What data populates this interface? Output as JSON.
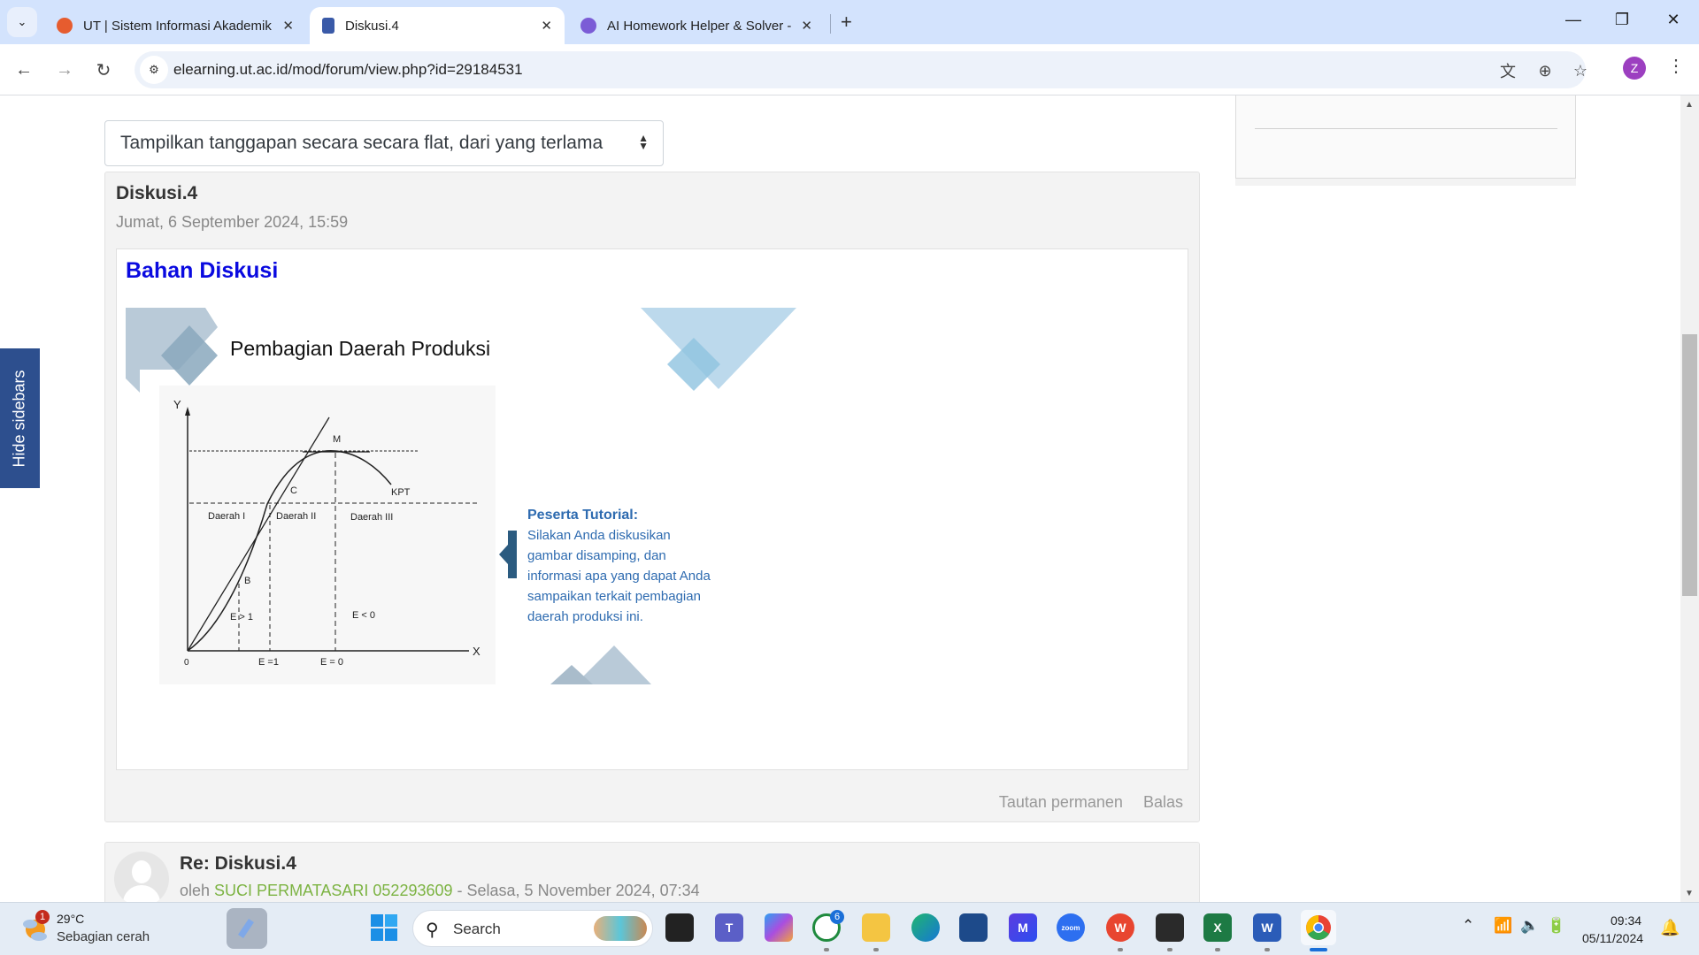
{
  "browser": {
    "tabs": [
      {
        "title": "UT | Sistem Informasi Akademik",
        "active": false,
        "favicon_color": "#e65c2f"
      },
      {
        "title": "Diskusi.4",
        "active": true,
        "favicon_color": "#3a5aa8"
      },
      {
        "title": "AI Homework Helper & Solver -",
        "active": false,
        "favicon_color": "#7b5cd6"
      }
    ],
    "close_glyph": "✕",
    "new_tab_glyph": "+",
    "url": "elearning.ut.ac.id/mod/forum/view.php?id=29184531",
    "profile_initial": "Z",
    "window_controls": {
      "minimize": "—",
      "restore": "❐",
      "close": "✕"
    },
    "nav": {
      "back": "←",
      "forward": "→",
      "reload": "↻"
    }
  },
  "page": {
    "hide_sidebars_label": "Hide sidebars",
    "sort_select": {
      "value": "Tampilkan tanggapan secara secara flat, dari yang terlama"
    },
    "discussion": {
      "title": "Diskusi.4",
      "date": "Jumat, 6 September 2024, 15:59",
      "content_heading": "Bahan Diskusi",
      "slide": {
        "title": "Pembagian Daerah Produksi",
        "graph_labels": {
          "y_axis": "Y",
          "x_axis": "X",
          "origin": "0",
          "point_m": "M",
          "point_c": "C",
          "point_b": "B",
          "curve": "KPT",
          "region_1": "Daerah I",
          "region_2": "Daerah II",
          "region_3": "Daerah III",
          "e_gt_1": "E > 1",
          "e_lt_0": "E < 0",
          "e_eq_1": "E =1",
          "e_eq_0": "E = 0"
        },
        "prompt_heading": "Peserta Tutorial:",
        "prompt_lines": [
          "Silakan Anda diskusikan",
          "gambar disamping, dan",
          "informasi apa yang dapat Anda",
          "sampaikan terkait pembagian",
          "daerah produksi ini."
        ]
      },
      "actions": {
        "permalink": "Tautan permanen",
        "reply": "Balas"
      }
    },
    "reply": {
      "title": "Re: Diskusi.4",
      "by_prefix": "oleh",
      "author": "SUCI PERMATASARI 052293609",
      "separator": " - ",
      "date": "Selasa, 5 November 2024, 07:34"
    }
  },
  "taskbar": {
    "weather": {
      "temp": "29°C",
      "desc": "Sebagian cerah",
      "badge": "1"
    },
    "search_label": "Search",
    "whatsapp_badge": "6",
    "apps": [
      "widgets",
      "start",
      "search",
      "task-view",
      "teams",
      "copilot",
      "whatsapp",
      "file-explorer",
      "edge",
      "store",
      "app-m",
      "zoom",
      "wps-office",
      "sticky-notes",
      "excel",
      "word",
      "chrome"
    ],
    "clock": {
      "time": "09:34",
      "date": "05/11/2024"
    }
  },
  "colors": {
    "accent_blue": "#0a0ae0",
    "sidebar_toggle": "#2d4f8e",
    "author_green": "#7cb342",
    "slide_text_blue": "#2e6bb0"
  }
}
